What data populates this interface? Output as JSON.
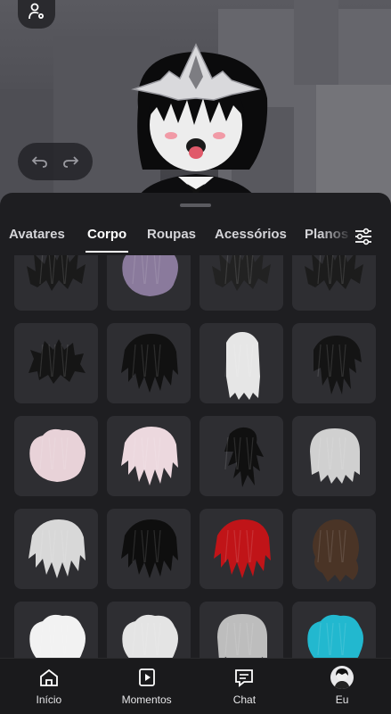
{
  "tabs": [
    {
      "label": "Avatares",
      "active": false
    },
    {
      "label": "Corpo",
      "active": true
    },
    {
      "label": "Roupas",
      "active": false
    },
    {
      "label": "Acessórios",
      "active": false
    },
    {
      "label": "Planos",
      "active": false
    }
  ],
  "icons": {
    "avatar_settings": "person-gear-icon",
    "undo": "undo-icon",
    "redo": "redo-icon",
    "filter": "sliders-icon"
  },
  "items": [
    {
      "name": "hair-1",
      "color": "#1a1a1a",
      "style": "spiky"
    },
    {
      "name": "hair-2",
      "color": "#8a7a9c",
      "style": "fluffy"
    },
    {
      "name": "hair-3",
      "color": "#222222",
      "style": "spiky"
    },
    {
      "name": "hair-4",
      "color": "#1c1c1c",
      "style": "spiky"
    },
    {
      "name": "hair-5",
      "color": "#151515",
      "style": "spiky-short"
    },
    {
      "name": "hair-6",
      "color": "#111111",
      "style": "shaggy"
    },
    {
      "name": "hair-7",
      "color": "#e6e6e6",
      "style": "long"
    },
    {
      "name": "hair-8",
      "color": "#141414",
      "style": "messy-long"
    },
    {
      "name": "hair-9",
      "color": "#e8d2d8",
      "style": "fluffy"
    },
    {
      "name": "hair-10",
      "color": "#ecd8de",
      "style": "shaggy"
    },
    {
      "name": "hair-11",
      "color": "#101010",
      "style": "wolf"
    },
    {
      "name": "hair-12",
      "color": "#d0d0d0",
      "style": "bob"
    },
    {
      "name": "hair-13",
      "color": "#d8d8d8",
      "style": "shaggy"
    },
    {
      "name": "hair-14",
      "color": "#0e0e0e",
      "style": "shaggy"
    },
    {
      "name": "hair-15",
      "color": "#c01418",
      "style": "shaggy"
    },
    {
      "name": "hair-16",
      "color": "#4a3426",
      "style": "wavy"
    },
    {
      "name": "hair-17",
      "color": "#f2f2f2",
      "style": "fluffy"
    },
    {
      "name": "hair-18",
      "color": "#e4e4e4",
      "style": "fluffy"
    },
    {
      "name": "hair-19",
      "color": "#bdbdbd",
      "style": "bob"
    },
    {
      "name": "hair-20",
      "color": "#22b8cf",
      "style": "fluffy"
    }
  ],
  "nav": [
    {
      "label": "Início",
      "icon": "home-icon"
    },
    {
      "label": "Momentos",
      "icon": "moments-icon"
    },
    {
      "label": "Chat",
      "icon": "chat-icon"
    },
    {
      "label": "Eu",
      "icon": "profile-avatar-icon"
    }
  ]
}
